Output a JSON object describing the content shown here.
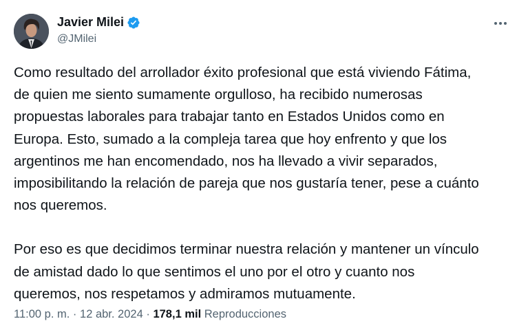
{
  "author": {
    "name": "Javier Milei",
    "handle": "@JMilei",
    "verified": true,
    "verified_color": "#1d9bf0"
  },
  "more_icon": "more-horizontal-icon",
  "tweet": {
    "paragraphs": [
      [
        "Como resultado del arrollador éxito profesional que está viviendo Fátima,",
        "de quien me siento sumamente orgulloso, ha recibido numerosas",
        "propuestas laborales para trabajar tanto en Estados Unidos como en",
        "Europa. Esto, sumado a la compleja tarea que hoy enfrento y que los",
        "argentinos me han encomendado, nos ha llevado a vivir separados,",
        "imposibilitando la relación de pareja que nos gustaría tener, pese a cuánto",
        "nos queremos."
      ],
      [
        "Por eso es que decidimos terminar nuestra relación y mantener un vínculo",
        "de amistad dado lo que sentimos el uno por el otro y cuanto nos",
        "queremos, nos respetamos y admiramos mutuamente."
      ]
    ]
  },
  "meta": {
    "time": "11:00 p. m.",
    "separator": "·",
    "date": "12 abr. 2024",
    "views_count": "178,1 mil",
    "views_label": "Reproducciones"
  }
}
